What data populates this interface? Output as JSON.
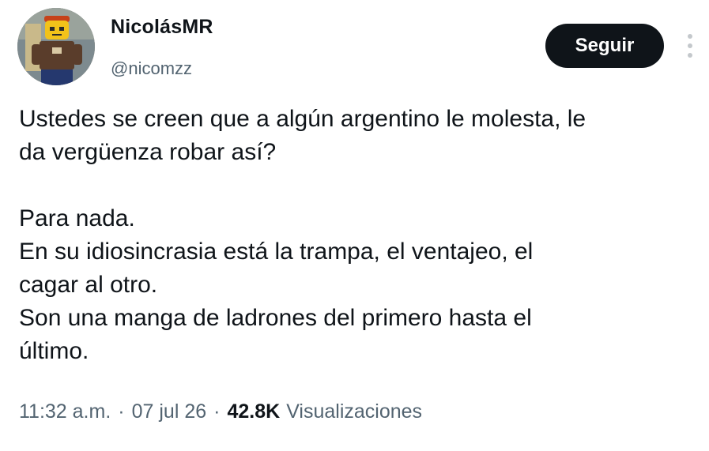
{
  "author": {
    "display_name": "NicolásMR",
    "handle": "@nicomzz"
  },
  "actions": {
    "follow_label": "Seguir",
    "more_icon": "more-vertical-icon"
  },
  "tweet": {
    "paragraphs": [
      "Ustedes se creen que a algún argentino le molesta, le\nda vergüenza robar así?",
      "Para nada.\nEn su idiosincrasia está la trampa, el ventajeo, el\ncagar al otro.\nSon una manga de ladrones del primero hasta el\núltimo."
    ]
  },
  "meta": {
    "time": "11:32 a.m.",
    "separator": "·",
    "date": "07 jul 26",
    "views_count": "42.8K",
    "views_label": "Visualizaciones"
  },
  "colors": {
    "text_primary": "#0f1419",
    "text_secondary": "#536471",
    "button_bg": "#0f1419",
    "button_text": "#ffffff"
  }
}
